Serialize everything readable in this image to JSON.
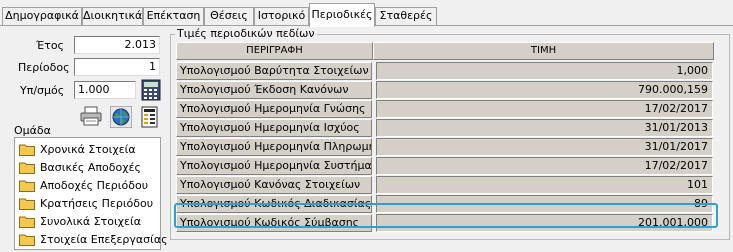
{
  "tabs": [
    {
      "label": "Δημογραφικά"
    },
    {
      "label": "Διοικητικά"
    },
    {
      "label": "Επέκταση"
    },
    {
      "label": "Θέσεις"
    },
    {
      "label": "Ιστορικό"
    },
    {
      "label": "Περιοδικές"
    },
    {
      "label": "Σταθερές"
    }
  ],
  "active_tab": "Περιοδικές",
  "params": {
    "year_label": "Έτος",
    "year_value": "2.013",
    "period_label": "Περίοδος",
    "period_value": "1",
    "calc_label": "Υπ/σμός",
    "calc_value": "1.000"
  },
  "group_label": "Ομάδα",
  "tree": [
    {
      "label": "Χρονικά Στοιχεία"
    },
    {
      "label": "Βασικές Αποδοχές"
    },
    {
      "label": "Αποδοχές Περιόδου"
    },
    {
      "label": "Κρατήσεις Περιόδου"
    },
    {
      "label": "Συνολικά Στοιχεία"
    },
    {
      "label": "Στοιχεία Επεξεργασίας"
    }
  ],
  "values_group_title": "Τιμές περιοδικών πεδίων",
  "grid": {
    "col_description": "ΠΕΡΙΓΡΑΦΗ",
    "col_value": "ΤΙΜΗ",
    "rows": [
      {
        "desc": "Υπολογισμού Βαρύτητα Στοιχείων",
        "value": "1,000"
      },
      {
        "desc": "Υπολογισμού Έκδοση Κανόνων",
        "value": "790.000,159"
      },
      {
        "desc": "Υπολογισμού Ημερομηνία Γνώσης",
        "value": "17/02/2017"
      },
      {
        "desc": "Υπολογισμού Ημερομηνία Ισχύος",
        "value": "31/01/2013"
      },
      {
        "desc": "Υπολογισμού Ημερομηνία Πληρωμής",
        "value": "31/01/2017"
      },
      {
        "desc": "Υπολογισμού Ημερομηνία Συστήματος",
        "value": "17/02/2017"
      },
      {
        "desc": "Υπολογισμού Κανόνας Στοιχείων",
        "value": "101"
      },
      {
        "desc": "Υπολογισμού Κωδικός Διαδικασίας",
        "value": "89"
      },
      {
        "desc": "Υπολογισμού Κωδικός Σύμβασης",
        "value": "201.001,000"
      }
    ]
  },
  "colors": {
    "highlight": "#2f9fd8",
    "grid_bg": "#d4d0c8",
    "folder": "#f2c94c"
  },
  "icons": [
    "printer-icon",
    "globe-icon",
    "calculator-icon",
    "report-icon",
    "folder-icon"
  ]
}
